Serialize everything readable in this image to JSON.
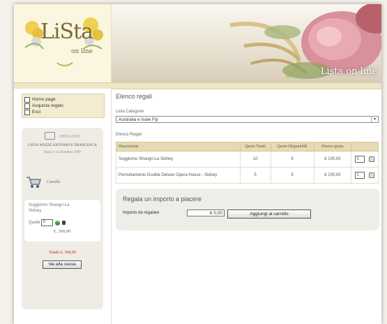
{
  "header": {
    "logo_text": "LiSta",
    "logo_sub": "on line",
    "banner_title": "Lista on line"
  },
  "sidebar": {
    "menu": [
      {
        "label": "Home page"
      },
      {
        "label": "Acquista regalo"
      },
      {
        "label": "Esci"
      }
    ],
    "list": {
      "code_label": "CREGALOPEP",
      "owner": "LISTA NOZZE ANTONIO E FRANCESCA",
      "wedding": "Sposi il 14 dicembre 2009"
    },
    "cart": {
      "label": "Carrello",
      "item_name": "Soggiorno Shangri-La Sidney",
      "qty_label": "Quote",
      "qty_value": "3",
      "price": "€. 300,00",
      "total": "Totale €. 300,00",
      "checkout_label": "Vai alla cassa"
    }
  },
  "content": {
    "title": "Elenco regali",
    "category_label": "Lista Categorie",
    "category_value": "Australia e Isole Fiji",
    "gifts_label": "Elenco Regali",
    "table": {
      "headers": [
        "Descrizione",
        "Quote Totali",
        "Quote Disponibili",
        "Prezzo quota"
      ],
      "rows": [
        {
          "desc": "Soggiorno Shangri-La Sidney",
          "total": "10",
          "available": "6",
          "price": "€ 100,00",
          "qty": "3"
        },
        {
          "desc": "Pernottamento Double Deluxe Opera House - Sidney",
          "total": "5",
          "available": "5",
          "price": "€ 100,00",
          "qty": "1"
        }
      ]
    },
    "gift": {
      "title": "Regala un importo a piacere",
      "amount_label": "Importo da regalare",
      "amount_value": "€ 0,00",
      "add_label": "Aggiungi al carrello"
    }
  },
  "colors": {
    "menu_bg": "#f3ecd2",
    "table_header_bg": "#e6dab2",
    "total_red": "#cc2222",
    "add_icon_green": "#2c9b3a"
  }
}
